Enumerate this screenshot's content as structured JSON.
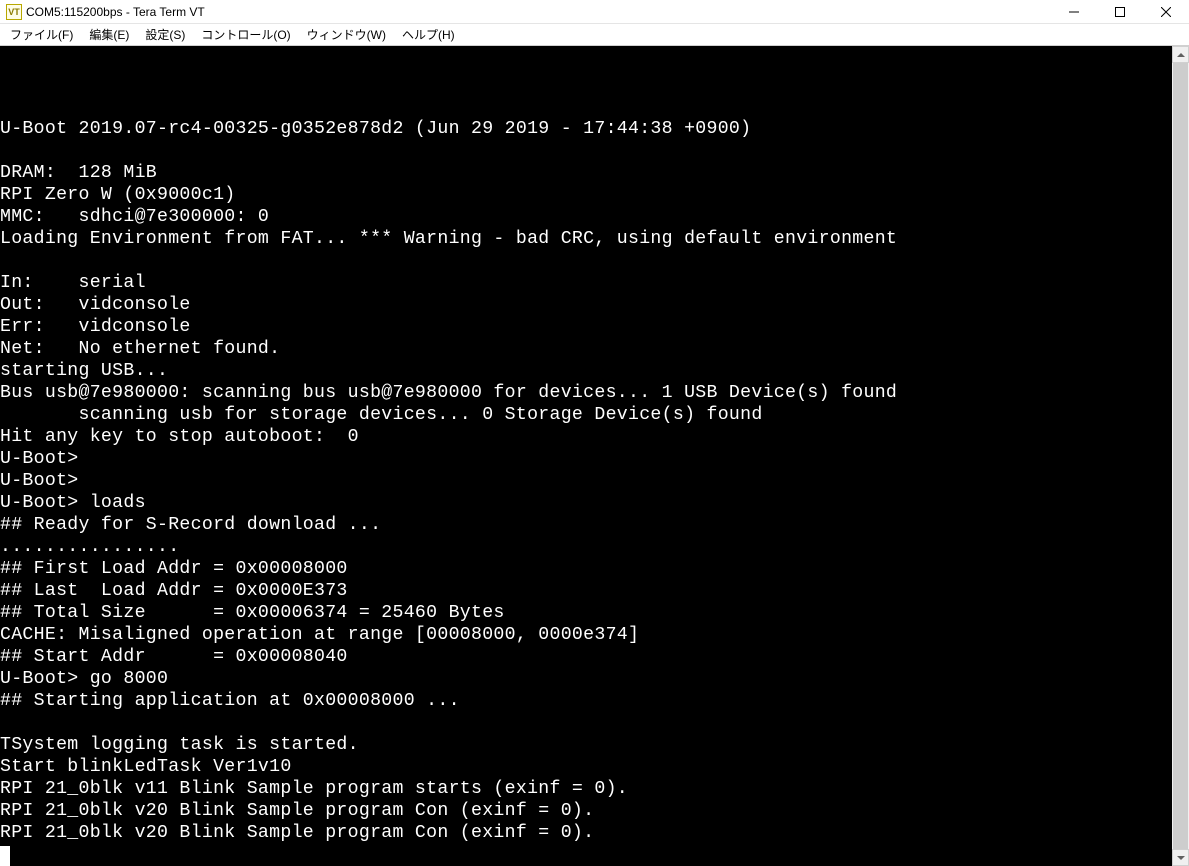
{
  "titlebar": {
    "icon_text": "VT",
    "title": "COM5:115200bps - Tera Term VT"
  },
  "menubar": {
    "items": [
      "ファイル(F)",
      "編集(E)",
      "設定(S)",
      "コントロール(O)",
      "ウィンドウ(W)",
      "ヘルプ(H)"
    ]
  },
  "terminal": {
    "lines": [
      "",
      "",
      "U-Boot 2019.07-rc4-00325-g0352e878d2 (Jun 29 2019 - 17:44:38 +0900)",
      "",
      "DRAM:  128 MiB",
      "RPI Zero W (0x9000c1)",
      "MMC:   sdhci@7e300000: 0",
      "Loading Environment from FAT... *** Warning - bad CRC, using default environment",
      "",
      "In:    serial",
      "Out:   vidconsole",
      "Err:   vidconsole",
      "Net:   No ethernet found.",
      "starting USB...",
      "Bus usb@7e980000: scanning bus usb@7e980000 for devices... 1 USB Device(s) found",
      "       scanning usb for storage devices... 0 Storage Device(s) found",
      "Hit any key to stop autoboot:  0",
      "U-Boot>",
      "U-Boot>",
      "U-Boot> loads",
      "## Ready for S-Record download ...",
      "................",
      "## First Load Addr = 0x00008000",
      "## Last  Load Addr = 0x0000E373",
      "## Total Size      = 0x00006374 = 25460 Bytes",
      "CACHE: Misaligned operation at range [00008000, 0000e374]",
      "## Start Addr      = 0x00008040",
      "U-Boot> go 8000",
      "## Starting application at 0x00008000 ...",
      "",
      "TSystem logging task is started.",
      "Start blinkLedTask Ver1v10",
      "RPI 21_0blk v11 Blink Sample program starts (exinf = 0).",
      "RPI 21_0blk v20 Blink Sample program Con (exinf = 0).",
      "RPI 21_0blk v20 Blink Sample program Con (exinf = 0)."
    ]
  }
}
